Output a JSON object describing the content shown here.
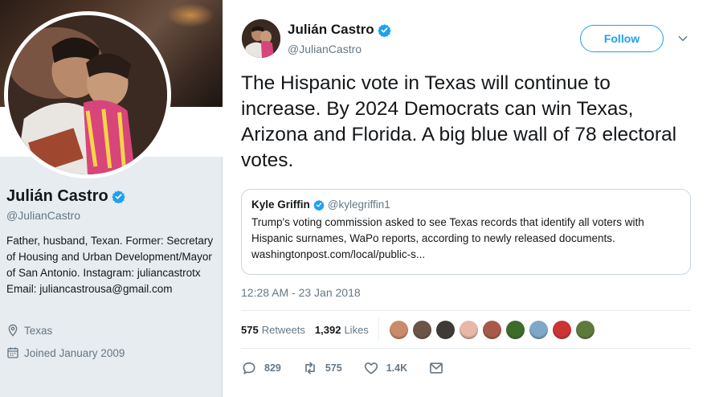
{
  "profile": {
    "name": "Julián Castro",
    "handle": "@JulianCastro",
    "bio": "Father, husband, Texan. Former: Secretary of Housing and Urban Development/Mayor of San Antonio. Instagram: juliancastrotx Email: juliancastrousa@gmail.com",
    "location": "Texas",
    "joined": "Joined January 2009"
  },
  "tweet": {
    "author_name": "Julián Castro",
    "author_handle": "@JulianCastro",
    "follow_label": "Follow",
    "text": "The Hispanic vote in Texas will continue to increase. By 2024 Democrats can win Texas, Arizona and Florida. A big blue wall of 78 electoral votes.",
    "timestamp": "12:28 AM - 23 Jan 2018",
    "quote": {
      "name": "Kyle Griffin",
      "handle": "@kylegriffin1",
      "text": "Trump's voting commission asked to see Texas records that identify all voters with Hispanic surnames, WaPo reports, according to newly released documents.",
      "link": "washingtonpost.com/local/public-s..."
    },
    "stats": {
      "retweets_count": "575",
      "retweets_label": "Retweets",
      "likes_count": "1,392",
      "likes_label": "Likes"
    },
    "likers": [
      {
        "color": "#c98b6a"
      },
      {
        "color": "#6b5446"
      },
      {
        "color": "#3f3a35"
      },
      {
        "color": "#e8b7a5"
      },
      {
        "color": "#a85a4a"
      },
      {
        "color": "#3d6b2a"
      },
      {
        "color": "#7fa8c8"
      },
      {
        "color": "#cc3333"
      },
      {
        "color": "#5e7a3a"
      }
    ],
    "actions": {
      "reply_count": "829",
      "retweet_count": "575",
      "like_count": "1.4K"
    }
  },
  "colors": {
    "accent": "#1da1f2",
    "muted": "#657786",
    "sidebar_bg": "#e6ecf0"
  },
  "icons": [
    "verified-badge-icon",
    "location-pin-icon",
    "calendar-icon",
    "chevron-down-icon",
    "reply-icon",
    "retweet-icon",
    "heart-icon",
    "direct-message-icon"
  ]
}
